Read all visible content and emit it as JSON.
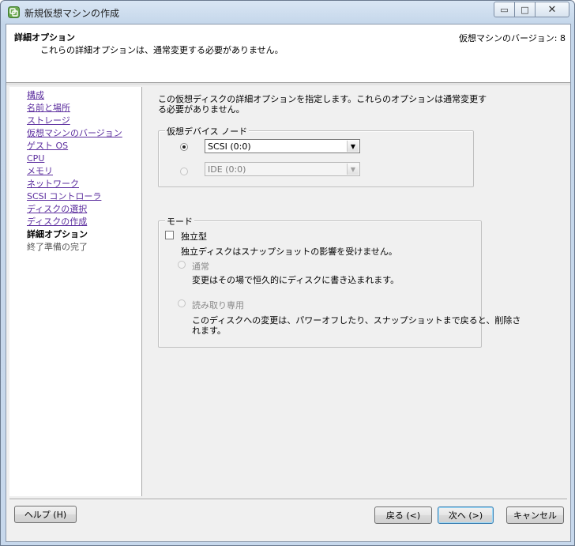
{
  "window": {
    "title": "新規仮想マシンの作成",
    "icon": "vsphere-app-icon"
  },
  "header": {
    "title": "詳細オプション",
    "subtitle": "これらの詳細オプションは、通常変更する必要がありません。",
    "version": "仮想マシンのバージョン: 8"
  },
  "nav": {
    "items": [
      {
        "label": "構成",
        "state": "link"
      },
      {
        "label": "名前と場所",
        "state": "link"
      },
      {
        "label": "ストレージ",
        "state": "link"
      },
      {
        "label": "仮想マシンのバージョン",
        "state": "link"
      },
      {
        "label": "ゲスト OS",
        "state": "link"
      },
      {
        "label": "CPU",
        "state": "link"
      },
      {
        "label": "メモリ",
        "state": "link"
      },
      {
        "label": "ネットワーク",
        "state": "link"
      },
      {
        "label": "SCSI コントローラ",
        "state": "link"
      },
      {
        "label": "ディスクの選択",
        "state": "link"
      },
      {
        "label": "ディスクの作成",
        "state": "link"
      },
      {
        "label": "詳細オプション",
        "state": "current"
      },
      {
        "label": "終了準備の完了",
        "state": "future"
      }
    ]
  },
  "main": {
    "description": "この仮想ディスクの詳細オプションを指定します。これらのオプションは通常変更する必要がありません。",
    "device_node": {
      "legend": "仮想デバイス ノード",
      "scsi_value": "SCSI (0:0)",
      "ide_value": "IDE (0:0)",
      "selected": "scsi"
    },
    "mode": {
      "legend": "モード",
      "independent_label": "独立型",
      "independent_checked": false,
      "independent_desc": "独立ディスクはスナップショットの影響を受けません。",
      "persistent_label": "通常",
      "persistent_desc": "変更はその場で恒久的にディスクに書き込まれます。",
      "nonpersistent_label": "読み取り専用",
      "nonpersistent_desc_1": "このディスクへの変更は、パワーオフしたり、スナップショットまで戻ると、削除さ",
      "nonpersistent_desc_2": "れます。"
    }
  },
  "footer": {
    "help": "ヘルプ (H)",
    "back": "戻る (<)",
    "next": "次へ (>)",
    "cancel": "キャンセル"
  },
  "window_buttons": {
    "minimize": "▭",
    "maximize": "□",
    "close": "✕"
  }
}
